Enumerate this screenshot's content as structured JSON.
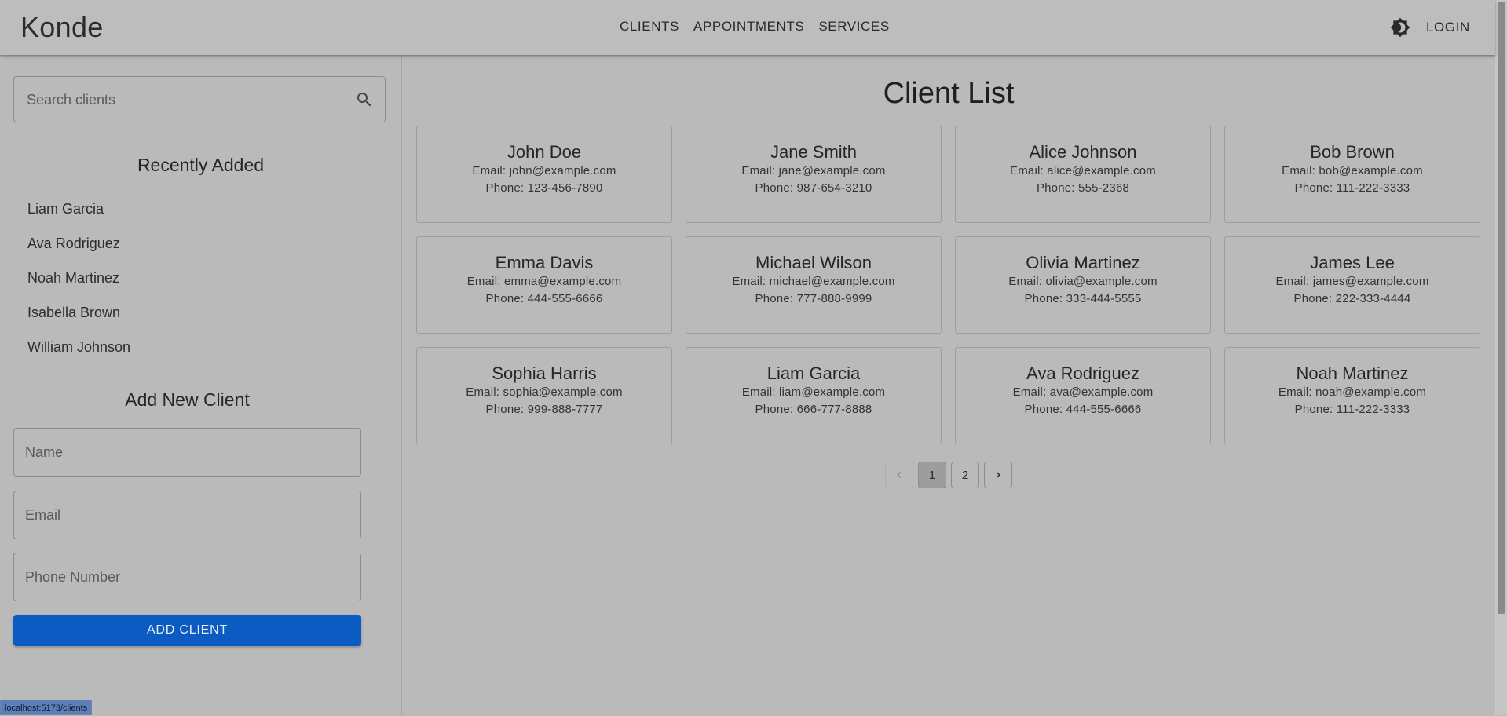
{
  "header": {
    "logo": "Konde",
    "nav": [
      "CLIENTS",
      "APPOINTMENTS",
      "SERVICES"
    ],
    "theme_icon": "brightness-icon",
    "login_label": "LOGIN"
  },
  "sidebar": {
    "search": {
      "placeholder": "Search clients",
      "icon": "search-icon"
    },
    "recent_title": "Recently Added",
    "recent": [
      "Liam Garcia",
      "Ava Rodriguez",
      "Noah Martinez",
      "Isabella Brown",
      "William Johnson"
    ],
    "add_title": "Add New Client",
    "form": {
      "name_placeholder": "Name",
      "email_placeholder": "Email",
      "phone_placeholder": "Phone Number",
      "submit_label": "ADD CLIENT"
    }
  },
  "main": {
    "title": "Client List",
    "clients": [
      {
        "name": "John Doe",
        "email": "Email: john@example.com",
        "phone": "Phone: 123-456-7890"
      },
      {
        "name": "Jane Smith",
        "email": "Email: jane@example.com",
        "phone": "Phone: 987-654-3210"
      },
      {
        "name": "Alice Johnson",
        "email": "Email: alice@example.com",
        "phone": "Phone: 555-2368"
      },
      {
        "name": "Bob Brown",
        "email": "Email: bob@example.com",
        "phone": "Phone: 111-222-3333"
      },
      {
        "name": "Emma Davis",
        "email": "Email: emma@example.com",
        "phone": "Phone: 444-555-6666"
      },
      {
        "name": "Michael Wilson",
        "email": "Email: michael@example.com",
        "phone": "Phone: 777-888-9999"
      },
      {
        "name": "Olivia Martinez",
        "email": "Email: olivia@example.com",
        "phone": "Phone: 333-444-5555"
      },
      {
        "name": "James Lee",
        "email": "Email: james@example.com",
        "phone": "Phone: 222-333-4444"
      },
      {
        "name": "Sophia Harris",
        "email": "Email: sophia@example.com",
        "phone": "Phone: 999-888-7777"
      },
      {
        "name": "Liam Garcia",
        "email": "Email: liam@example.com",
        "phone": "Phone: 666-777-8888"
      },
      {
        "name": "Ava Rodriguez",
        "email": "Email: ava@example.com",
        "phone": "Phone: 444-555-6666"
      },
      {
        "name": "Noah Martinez",
        "email": "Email: noah@example.com",
        "phone": "Phone: 111-222-3333"
      }
    ],
    "pagination": {
      "pages": [
        "1",
        "2"
      ],
      "current_page": "1",
      "prev_icon": "chevron-left-icon",
      "next_icon": "chevron-right-icon"
    }
  },
  "status_bar": {
    "url": "localhost:5173/clients"
  },
  "colors": {
    "accent": "#0b5bc3",
    "background": "#bababa"
  }
}
